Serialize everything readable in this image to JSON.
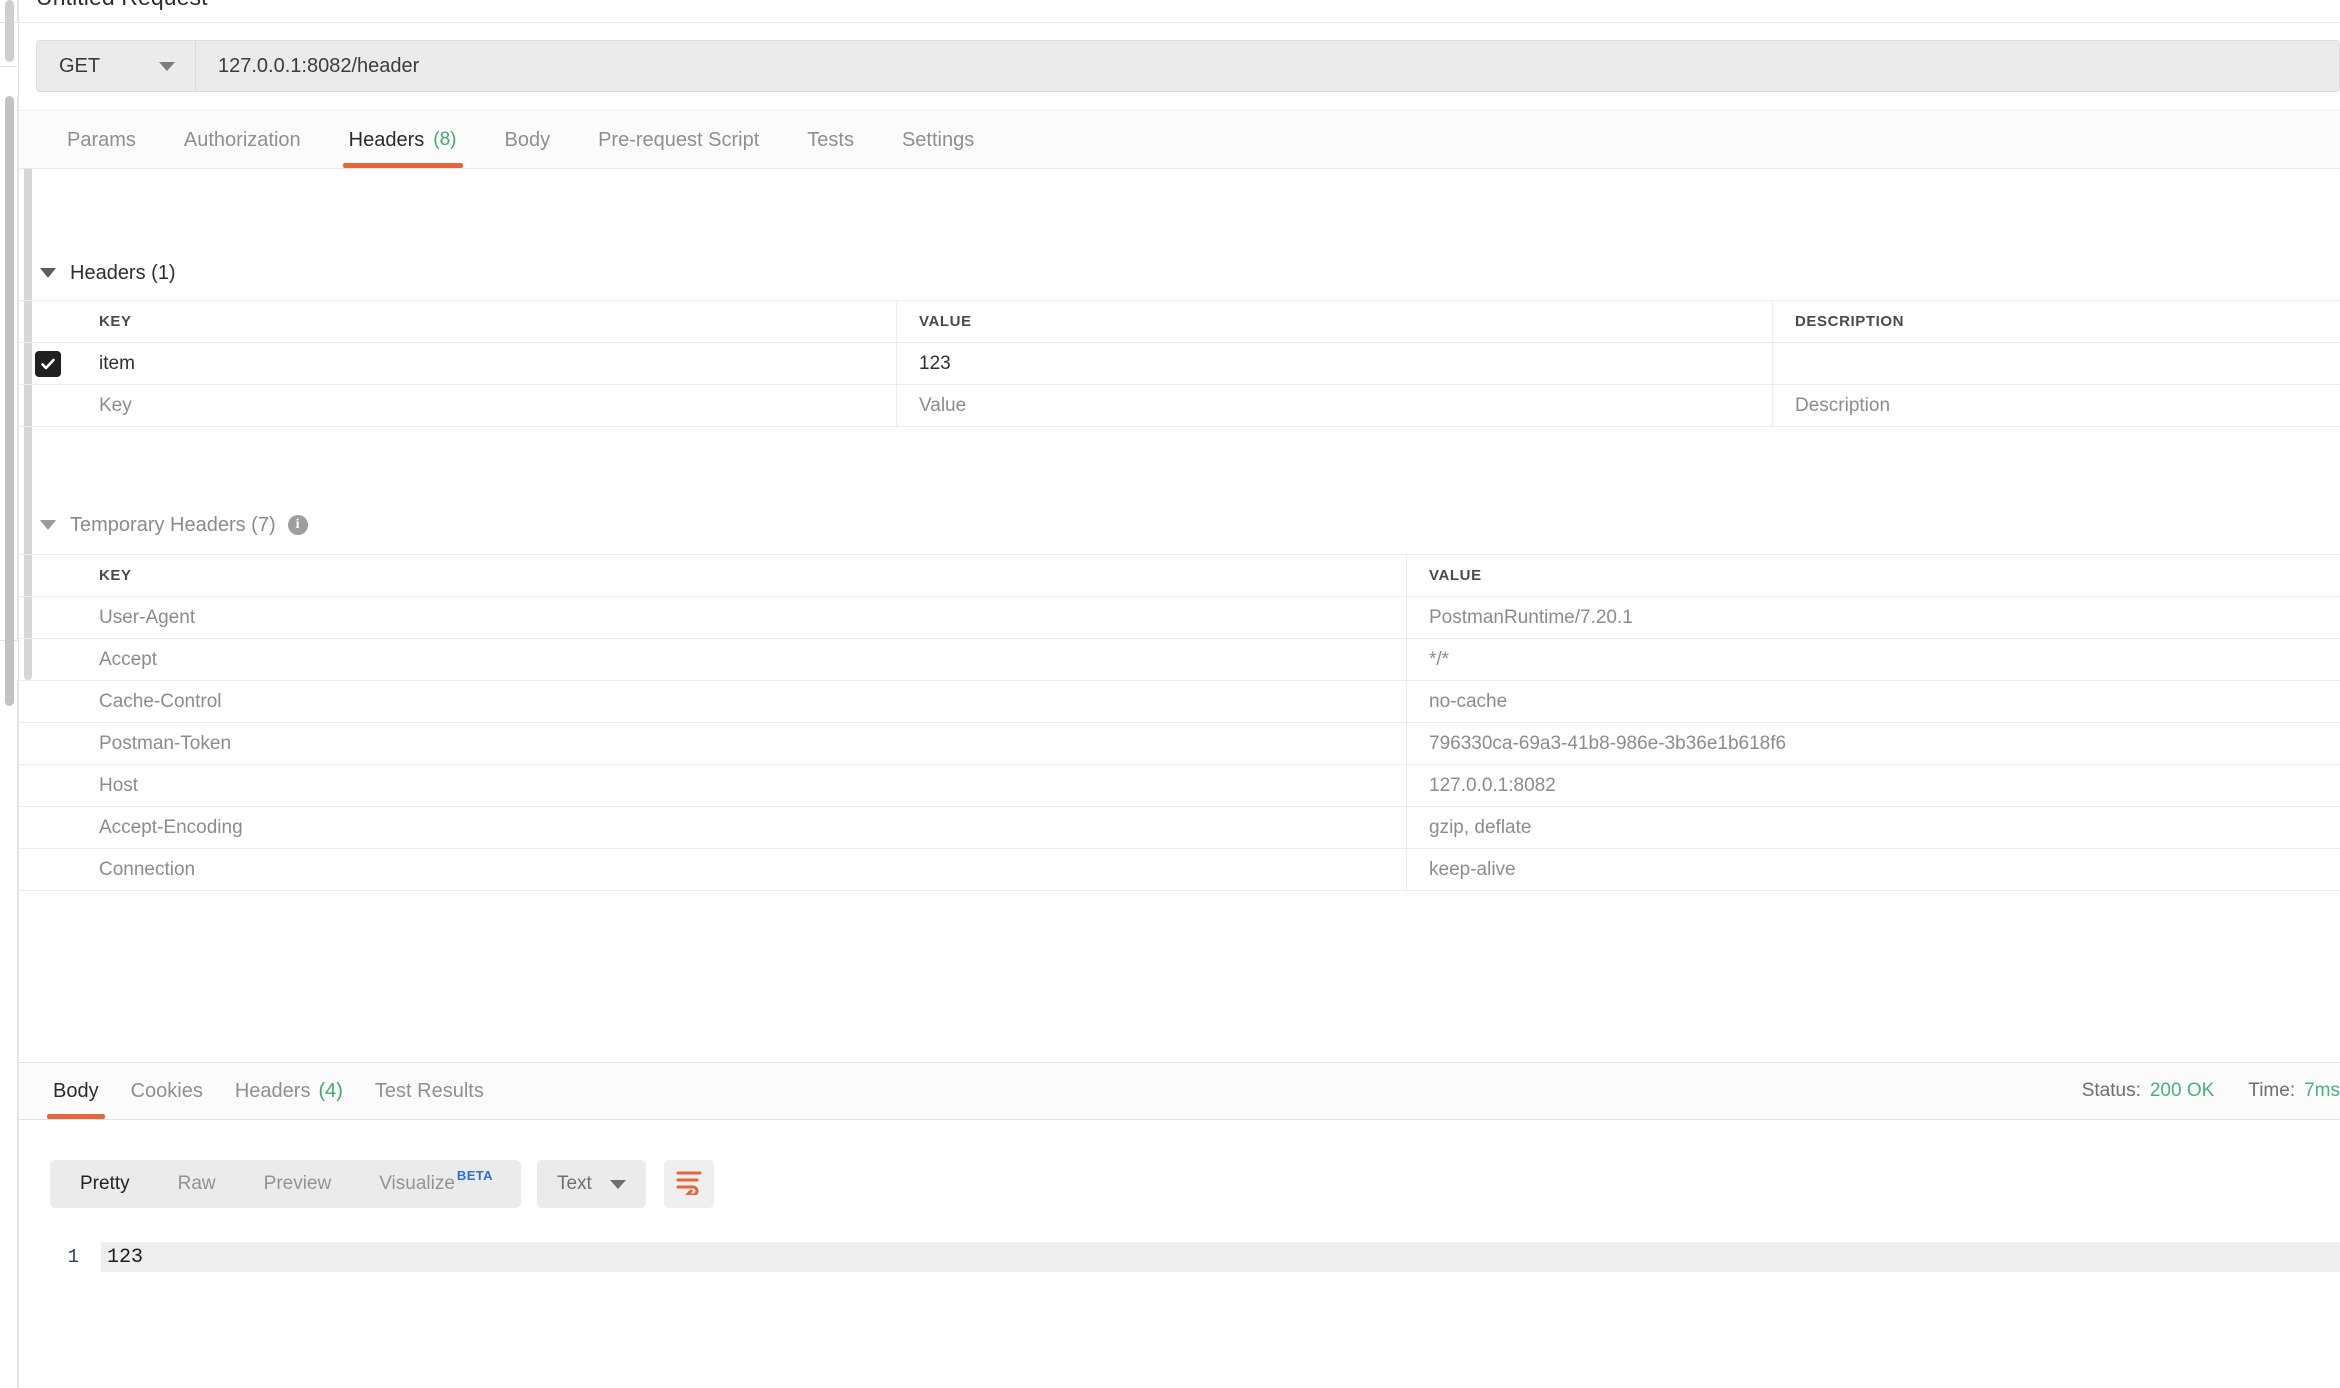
{
  "request": {
    "title": "Untitled Request",
    "method": "GET",
    "url": "127.0.0.1:8082/header",
    "tabs": [
      {
        "label": "Params",
        "count": "",
        "active": false
      },
      {
        "label": "Authorization",
        "count": "",
        "active": false
      },
      {
        "label": "Headers",
        "count": "(8)",
        "active": true
      },
      {
        "label": "Body",
        "count": "",
        "active": false
      },
      {
        "label": "Pre-request Script",
        "count": "",
        "active": false
      },
      {
        "label": "Tests",
        "count": "",
        "active": false
      },
      {
        "label": "Settings",
        "count": "",
        "active": false
      }
    ]
  },
  "headers_section": {
    "label": "Headers (1)",
    "columns": {
      "key": "KEY",
      "value": "VALUE",
      "description": "DESCRIPTION"
    },
    "rows": [
      {
        "checked": true,
        "key": "item",
        "value": "123",
        "description": "",
        "placeholder": false
      },
      {
        "checked": false,
        "key": "Key",
        "value": "Value",
        "description": "Description",
        "placeholder": true
      }
    ]
  },
  "temp_headers_section": {
    "label": "Temporary Headers (7)",
    "info_icon": "info-icon",
    "columns": {
      "key": "KEY",
      "value": "VALUE"
    },
    "rows": [
      {
        "key": "User-Agent",
        "value": "PostmanRuntime/7.20.1"
      },
      {
        "key": "Accept",
        "value": "*/*"
      },
      {
        "key": "Cache-Control",
        "value": "no-cache"
      },
      {
        "key": "Postman-Token",
        "value": "796330ca-69a3-41b8-986e-3b36e1b618f6"
      },
      {
        "key": "Host",
        "value": "127.0.0.1:8082"
      },
      {
        "key": "Accept-Encoding",
        "value": "gzip, deflate"
      },
      {
        "key": "Connection",
        "value": "keep-alive"
      }
    ]
  },
  "response": {
    "tabs": [
      {
        "label": "Body",
        "count": "",
        "active": true
      },
      {
        "label": "Cookies",
        "count": "",
        "active": false
      },
      {
        "label": "Headers",
        "count": "(4)",
        "active": false
      },
      {
        "label": "Test Results",
        "count": "",
        "active": false
      }
    ],
    "status_label": "Status:",
    "status_value": "200 OK",
    "time_label": "Time:",
    "time_value": "7ms",
    "format_tabs": [
      {
        "label": "Pretty",
        "active": true,
        "badge": ""
      },
      {
        "label": "Raw",
        "active": false,
        "badge": ""
      },
      {
        "label": "Preview",
        "active": false,
        "badge": ""
      },
      {
        "label": "Visualize",
        "active": false,
        "badge": "BETA"
      }
    ],
    "type_selector": "Text",
    "wrap_icon": "word-wrap-icon",
    "body_lines": [
      {
        "num": "1",
        "text": "123"
      }
    ]
  },
  "colors": {
    "accent": "#e2673a",
    "success": "#4caf7d",
    "beta": "#2f6fd0",
    "toolbar_bg": "#ebebeb"
  }
}
